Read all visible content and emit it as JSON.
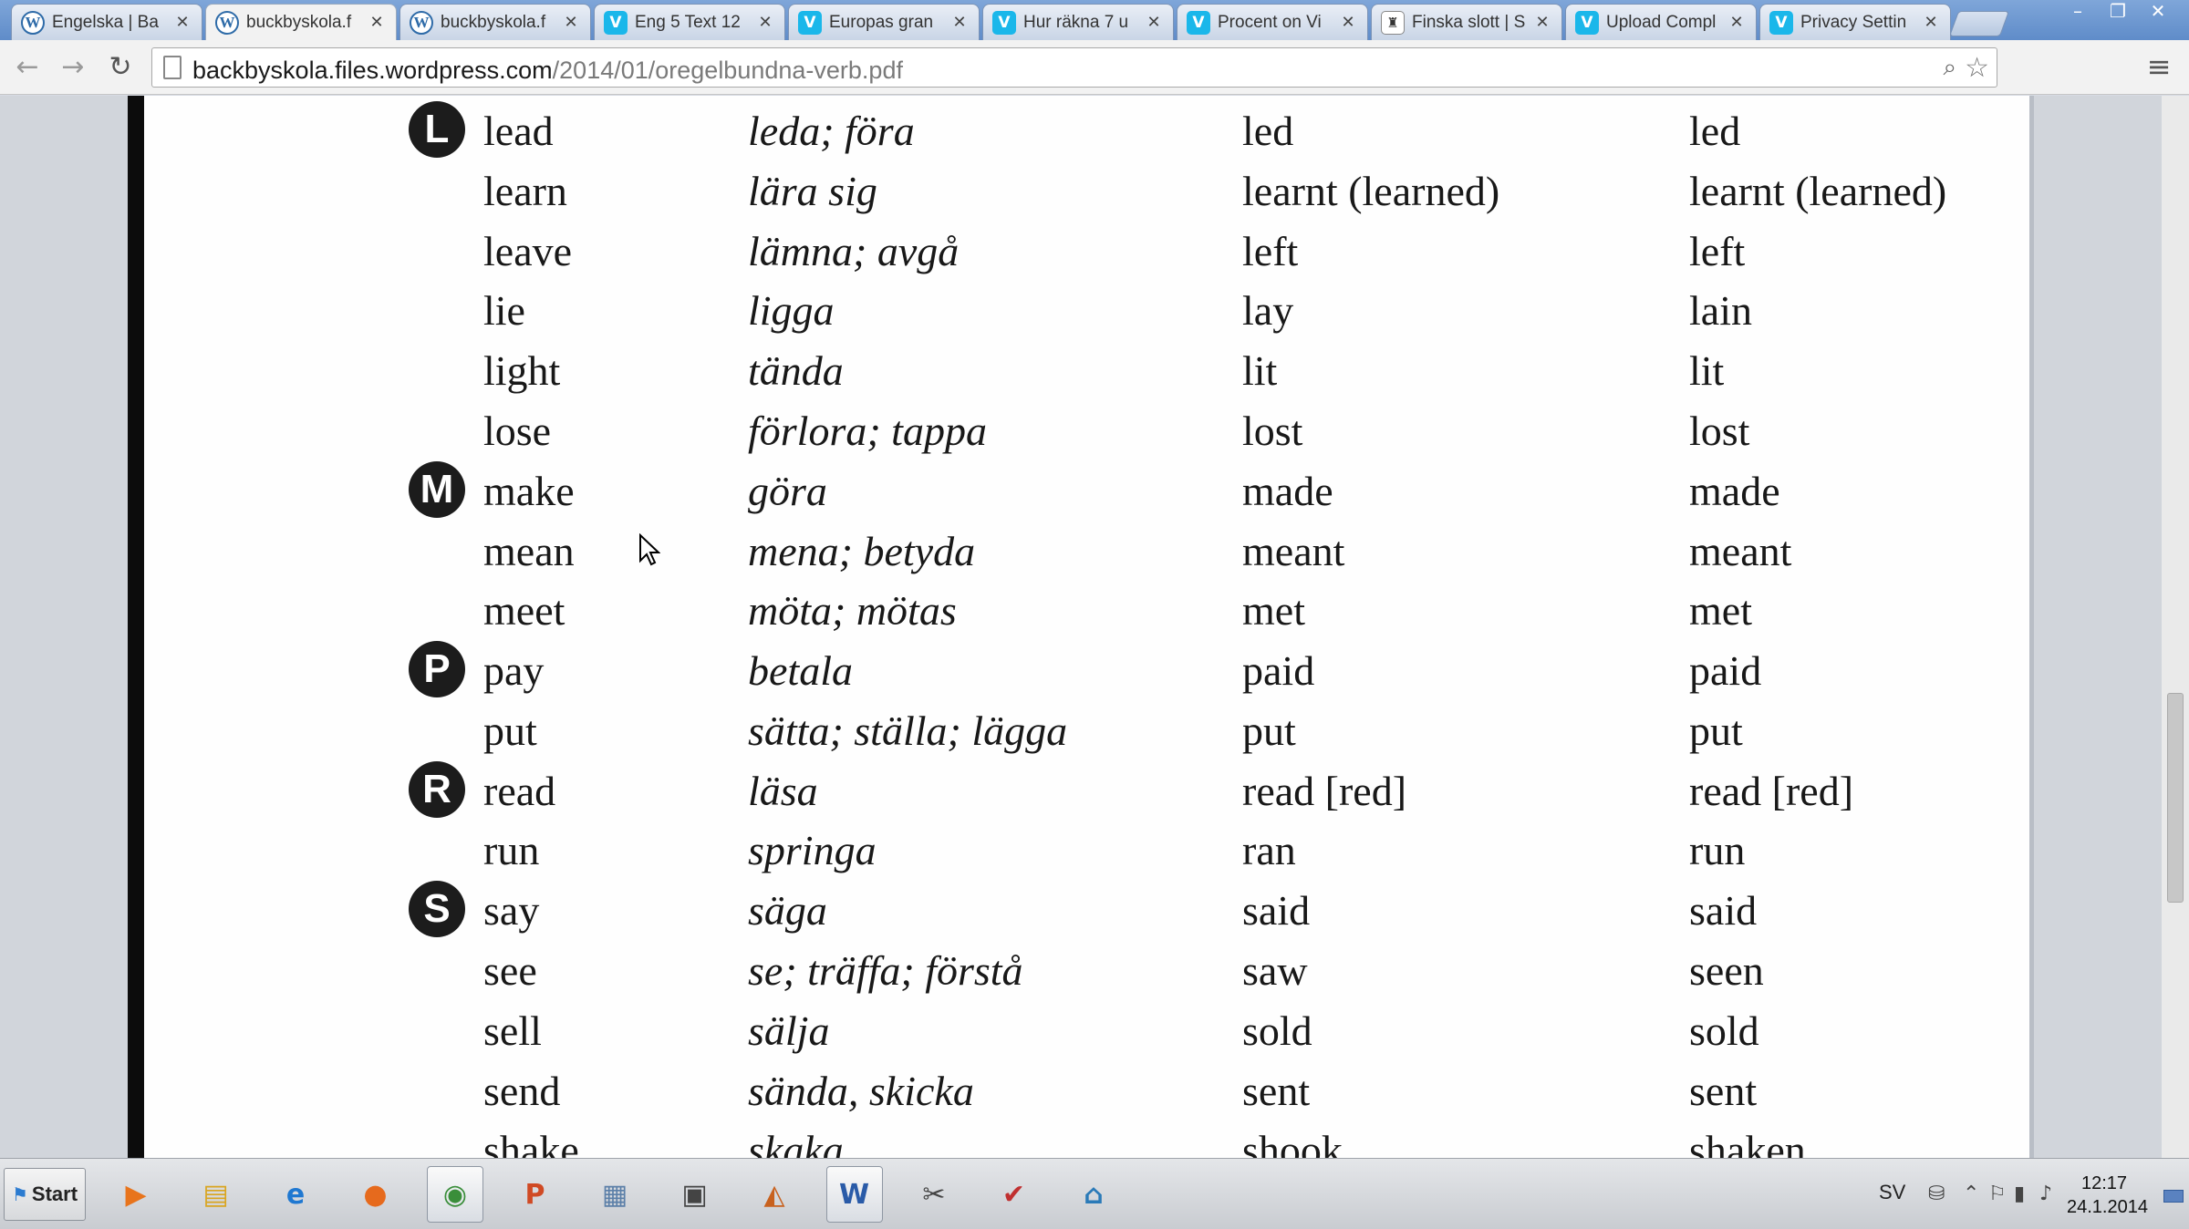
{
  "browser": {
    "tabs": [
      {
        "title": "Engelska | Ba",
        "favicon": "wordpress-icon",
        "active": false
      },
      {
        "title": "buckbyskola.f",
        "favicon": "wordpress-icon",
        "active": true
      },
      {
        "title": "buckbyskola.f",
        "favicon": "wordpress-icon",
        "active": false
      },
      {
        "title": "Eng 5 Text 12",
        "favicon": "vimeo-icon",
        "active": false
      },
      {
        "title": "Europas gran",
        "favicon": "vimeo-icon",
        "active": false
      },
      {
        "title": "Hur räkna 7 u",
        "favicon": "vimeo-icon",
        "active": false
      },
      {
        "title": "Procent on Vi",
        "favicon": "vimeo-icon",
        "active": false
      },
      {
        "title": "Finska slott | S",
        "favicon": "castle-icon",
        "active": false
      },
      {
        "title": "Upload Compl",
        "favicon": "vimeo-icon",
        "active": false
      },
      {
        "title": "Privacy Settin",
        "favicon": "vimeo-icon",
        "active": false
      }
    ],
    "address": {
      "host": "backbyskola.files.wordpress.com",
      "path": "/2014/01/oregelbundna-verb.pdf"
    }
  },
  "pdf": {
    "section_letters": [
      {
        "letter": "L",
        "row": 0
      },
      {
        "letter": "M",
        "row": 6
      },
      {
        "letter": "P",
        "row": 9
      },
      {
        "letter": "R",
        "row": 11
      },
      {
        "letter": "S",
        "row": 13
      }
    ],
    "rows": [
      {
        "base": "lead",
        "translation": "leda; föra",
        "past": "led",
        "participle": "led"
      },
      {
        "base": "learn",
        "translation": "lära sig",
        "past": "learnt (learned)",
        "participle": "learnt (learned)"
      },
      {
        "base": "leave",
        "translation": "lämna; avgå",
        "past": "left",
        "participle": "left"
      },
      {
        "base": "lie",
        "translation": "ligga",
        "past": "lay",
        "participle": "lain"
      },
      {
        "base": "light",
        "translation": "tända",
        "past": "lit",
        "participle": "lit"
      },
      {
        "base": "lose",
        "translation": "förlora; tappa",
        "past": "lost",
        "participle": "lost"
      },
      {
        "base": "make",
        "translation": "göra",
        "past": "made",
        "participle": "made"
      },
      {
        "base": "mean",
        "translation": "mena; betyda",
        "past": "meant",
        "participle": "meant"
      },
      {
        "base": "meet",
        "translation": "möta; mötas",
        "past": "met",
        "participle": "met"
      },
      {
        "base": "pay",
        "translation": "betala",
        "past": "paid",
        "participle": "paid"
      },
      {
        "base": "put",
        "translation": "sätta; ställa; lägga",
        "past": "put",
        "participle": "put"
      },
      {
        "base": "read",
        "translation": "läsa",
        "past": "read [red]",
        "participle": "read [red]"
      },
      {
        "base": "run",
        "translation": "springa",
        "past": "ran",
        "participle": "run"
      },
      {
        "base": "say",
        "translation": "säga",
        "past": "said",
        "participle": "said"
      },
      {
        "base": "see",
        "translation": "se; träffa; förstå",
        "past": "saw",
        "participle": "seen"
      },
      {
        "base": "sell",
        "translation": "sälja",
        "past": "sold",
        "participle": "sold"
      },
      {
        "base": "send",
        "translation": "sända, skicka",
        "past": "sent",
        "participle": "sent"
      },
      {
        "base": "shake",
        "translation": "skaka",
        "past": "shook",
        "participle": "shaken"
      }
    ]
  },
  "taskbar": {
    "start_label": "Start",
    "apps": [
      {
        "name": "media-player-icon",
        "glyph": "▶",
        "color": "#e8741c",
        "active": false
      },
      {
        "name": "file-explorer-icon",
        "glyph": "▤",
        "color": "#d9a520",
        "active": false
      },
      {
        "name": "internet-explorer-icon",
        "glyph": "e",
        "color": "#1f78d1",
        "active": false
      },
      {
        "name": "firefox-icon",
        "glyph": "●",
        "color": "#e66a1d",
        "active": false
      },
      {
        "name": "chrome-icon",
        "glyph": "◉",
        "color": "#3a8e3a",
        "active": true
      },
      {
        "name": "powerpoint-icon",
        "glyph": "P",
        "color": "#d04a24",
        "active": false
      },
      {
        "name": "calculator-icon",
        "glyph": "▦",
        "color": "#5b7fa8",
        "active": false
      },
      {
        "name": "window-app-icon",
        "glyph": "▣",
        "color": "#444444",
        "active": false
      },
      {
        "name": "sketch-app-icon",
        "glyph": "◭",
        "color": "#c8611e",
        "active": false
      },
      {
        "name": "word-icon",
        "glyph": "W",
        "color": "#2a5ba8",
        "active": true
      },
      {
        "name": "scissors-tool-icon",
        "glyph": "✂",
        "color": "#444444",
        "active": false
      },
      {
        "name": "checklist-app-icon",
        "glyph": "✔",
        "color": "#c03030",
        "active": false
      },
      {
        "name": "home-app-icon",
        "glyph": "⌂",
        "color": "#2a7ab8",
        "active": false
      }
    ],
    "language": "SV",
    "time": "12:17",
    "date": "24.1.2014"
  }
}
